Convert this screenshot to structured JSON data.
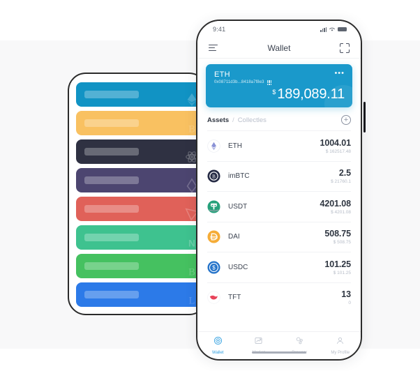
{
  "canvas": {
    "background": "#ffffff",
    "panel_background": "#f8f8f9"
  },
  "back_phone": {
    "name": "card-stack-phone",
    "cards": [
      {
        "label": "eth-card",
        "color": "#1193c4",
        "icon": "ethereum-icon"
      },
      {
        "label": "btc-card",
        "color": "#f9c161",
        "icon": "bitcoin-icon"
      },
      {
        "label": "atom-card",
        "color": "#2f3142",
        "icon": "cosmos-atom-icon"
      },
      {
        "label": "eos-card",
        "color": "#4c4570",
        "icon": "eos-drop-icon"
      },
      {
        "label": "trx-card",
        "color": "#e06159",
        "icon": "tron-icon"
      },
      {
        "label": "neo-card",
        "color": "#3ec28f",
        "icon": "neo-icon"
      },
      {
        "label": "bch-card",
        "color": "#45c160",
        "icon": "bitcoin-cash-icon"
      },
      {
        "label": "ltc-card",
        "color": "#2c7ae8",
        "icon": "litecoin-icon"
      }
    ]
  },
  "phone": {
    "status_bar": {
      "time": "9:41",
      "signal_icon": "cellular-signal-icon",
      "wifi_icon": "wifi-icon",
      "battery_icon": "battery-icon"
    },
    "navbar": {
      "menu_icon": "menu-icon",
      "title": "Wallet",
      "scan_icon": "scan-qr-icon"
    },
    "balance_card": {
      "symbol": "ETH",
      "address": "0x08711d3b...8418a7f8e3",
      "qr_icon": "qr-code-icon",
      "more_icon": "more-options-icon",
      "currency_symbol": "$",
      "amount": "189,089.11",
      "color": "#1a99cb"
    },
    "assets_header": {
      "tab_assets": "Assets",
      "separator": "/",
      "tab_collectibles": "Collectles",
      "add_icon": "add-circle-icon"
    },
    "assets": [
      {
        "symbol": "ETH",
        "amount": "1004.01",
        "fiat": "$ 162517.48",
        "icon": "ethereum-icon",
        "color": "#8a92d6"
      },
      {
        "symbol": "imBTC",
        "amount": "2.5",
        "fiat": "$ 21760.1",
        "icon": "imbtc-icon",
        "color": "#262b45"
      },
      {
        "symbol": "USDT",
        "amount": "4201.08",
        "fiat": "$ 4201.08",
        "icon": "tether-icon",
        "color": "#26a17b"
      },
      {
        "symbol": "DAI",
        "amount": "508.75",
        "fiat": "$ 508.75",
        "icon": "dai-icon",
        "color": "#f5ac37"
      },
      {
        "symbol": "USDC",
        "amount": "101.25",
        "fiat": "$ 101.25",
        "icon": "usd-coin-icon",
        "color": "#2775ca"
      },
      {
        "symbol": "TFT",
        "amount": "13",
        "fiat": "0",
        "icon": "tft-bird-icon",
        "color": "#e8435a"
      }
    ],
    "tabbar": [
      {
        "label": "Wallet",
        "icon": "wallet-icon",
        "active": true
      },
      {
        "label": "Market",
        "icon": "market-icon",
        "active": false
      },
      {
        "label": "Browser",
        "icon": "browser-icon",
        "active": false
      },
      {
        "label": "My Profile",
        "icon": "profile-icon",
        "active": false
      }
    ],
    "home_indicator": "home-indicator",
    "accent_color": "#2f9fe0"
  }
}
